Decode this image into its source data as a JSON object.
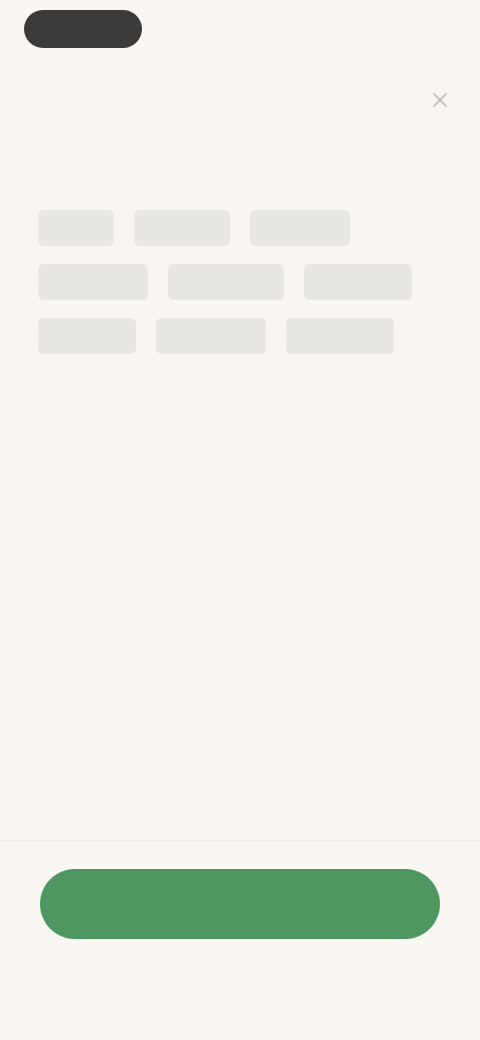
{
  "header": {
    "back_label": "",
    "close_icon": "close-icon"
  },
  "main": {
    "title": "",
    "subtitle": "",
    "section_heading": "",
    "chips": [
      [
        "",
        "",
        ""
      ],
      [
        "",
        "",
        ""
      ],
      [
        "",
        "",
        ""
      ]
    ]
  },
  "footer": {
    "primary_button_label": ""
  },
  "colors": {
    "background": "#f9f6f3",
    "accent": "#4f9760",
    "chip_background": "#e9e7e3"
  }
}
